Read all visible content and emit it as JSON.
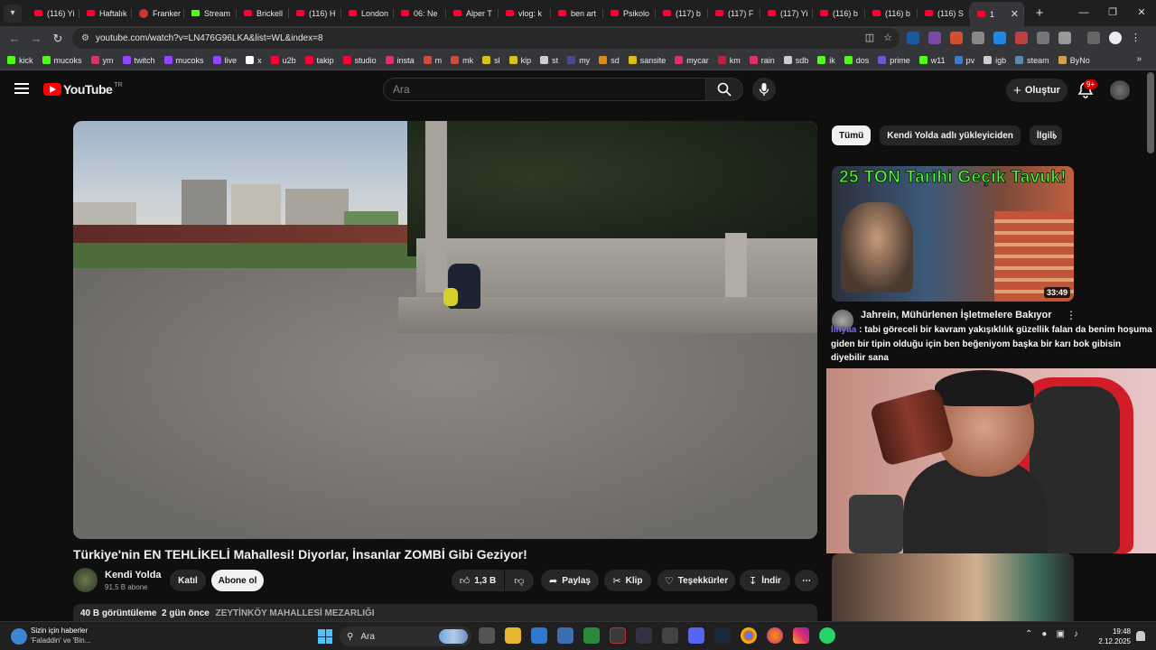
{
  "browser": {
    "tabs": [
      {
        "label": "(116) Yi",
        "kind": "yt"
      },
      {
        "label": "Haftalık",
        "kind": "yt"
      },
      {
        "label": "Franker",
        "kind": "round"
      },
      {
        "label": "Stream",
        "kind": "kick"
      },
      {
        "label": "Brickell",
        "kind": "yt"
      },
      {
        "label": "(116) H",
        "kind": "yt"
      },
      {
        "label": "London",
        "kind": "yt"
      },
      {
        "label": "06: Ne",
        "kind": "yt"
      },
      {
        "label": "Alper T",
        "kind": "yt"
      },
      {
        "label": "vlog: k",
        "kind": "yt"
      },
      {
        "label": "ben art",
        "kind": "yt"
      },
      {
        "label": "Psikolo",
        "kind": "yt"
      },
      {
        "label": "(117) b",
        "kind": "yt"
      },
      {
        "label": "(117) F",
        "kind": "yt"
      },
      {
        "label": "(117) Yi",
        "kind": "yt"
      },
      {
        "label": "(116) b",
        "kind": "yt"
      },
      {
        "label": "(116) b",
        "kind": "yt"
      },
      {
        "label": "(116) S",
        "kind": "yt"
      },
      {
        "label": "1",
        "kind": "yt",
        "active": true
      }
    ],
    "url": "youtube.com/watch?v=LN476G96LKA&list=WL&index=8",
    "bookmarks": [
      {
        "label": "kick",
        "color": "#53fc18"
      },
      {
        "label": "mucoks",
        "color": "#53fc18"
      },
      {
        "label": "ym",
        "color": "#e0306a"
      },
      {
        "label": "twitch",
        "color": "#9146ff"
      },
      {
        "label": "mucoks",
        "color": "#9146ff"
      },
      {
        "label": "live",
        "color": "#9146ff"
      },
      {
        "label": "x",
        "color": "#ffffff"
      },
      {
        "label": "u2b",
        "color": "#ff0033"
      },
      {
        "label": "takip",
        "color": "#ff0033"
      },
      {
        "label": "studio",
        "color": "#ff0033"
      },
      {
        "label": "insta",
        "color": "#e1306c"
      },
      {
        "label": "m",
        "color": "#d04a3a"
      },
      {
        "label": "mk",
        "color": "#d04a3a"
      },
      {
        "label": "sl",
        "color": "#d9c21a"
      },
      {
        "label": "kip",
        "color": "#d9c21a"
      },
      {
        "label": "st",
        "color": "#cccccc"
      },
      {
        "label": "my",
        "color": "#4a4a8a"
      },
      {
        "label": "sd",
        "color": "#e08a1a"
      },
      {
        "label": "sansite",
        "color": "#d9c21a"
      },
      {
        "label": "mycar",
        "color": "#e0306a"
      },
      {
        "label": "km",
        "color": "#c02040"
      },
      {
        "label": "rain",
        "color": "#e0306a"
      },
      {
        "label": "sdb",
        "color": "#cccccc"
      },
      {
        "label": "ik",
        "color": "#53fc18"
      },
      {
        "label": "dos",
        "color": "#53fc18"
      },
      {
        "label": "prime",
        "color": "#6a5acd"
      },
      {
        "label": "w11",
        "color": "#53fc18"
      },
      {
        "label": "pv",
        "color": "#3a7ad0"
      },
      {
        "label": "igb",
        "color": "#cccccc"
      },
      {
        "label": "steam",
        "color": "#5a8ab0"
      },
      {
        "label": "ByNo",
        "color": "#d0a050"
      }
    ]
  },
  "youtube": {
    "logo_text": "YouTube",
    "logo_region": "TR",
    "search_placeholder": "Ara",
    "create_label": "Oluştur",
    "notif_count": "9+",
    "video": {
      "title": "Türkiye'nin EN TEHLİKELİ Mahallesi! Diyorlar, İnsanlar ZOMBİ Gibi Geziyor!",
      "channel": "Kendi Yolda",
      "subscribers": "91,5 B abone",
      "join_label": "Katıl",
      "subscribe_label": "Abone ol",
      "likes": "1,3 B",
      "share_label": "Paylaş",
      "clip_label": "Klip",
      "thanks_label": "Teşekkürler",
      "download_label": "İndir",
      "views": "40 B görüntüleme",
      "age": "2 gün önce",
      "location_tag": "ZEYTİNKÖY MAHALLESİ MEZARLIĞI"
    },
    "chips": [
      "Tümü",
      "Kendi Yolda adlı yükleyiciden",
      "İlgili"
    ],
    "recommendation": {
      "thumb_text": "25 TON Tarihi Geçik Tavuk!",
      "duration": "33:49",
      "title": "Jahrein, Mühürlenen İşletmelere Bakıyor"
    },
    "chat_overlay": {
      "user": "linyaa",
      "message": "tabi göreceli bir kavram yakışıklılık güzellik falan da benim hoşuma giden bir tipin olduğu için ben beğeniyom başka bir karı bok gibisin diyebilir sana"
    }
  },
  "taskbar": {
    "news_title": "Sizin için haberler",
    "news_sub": "'Faladdin' ve 'Bin...",
    "search_label": "Ara",
    "time": "19:48",
    "date": "2.12.2025"
  }
}
